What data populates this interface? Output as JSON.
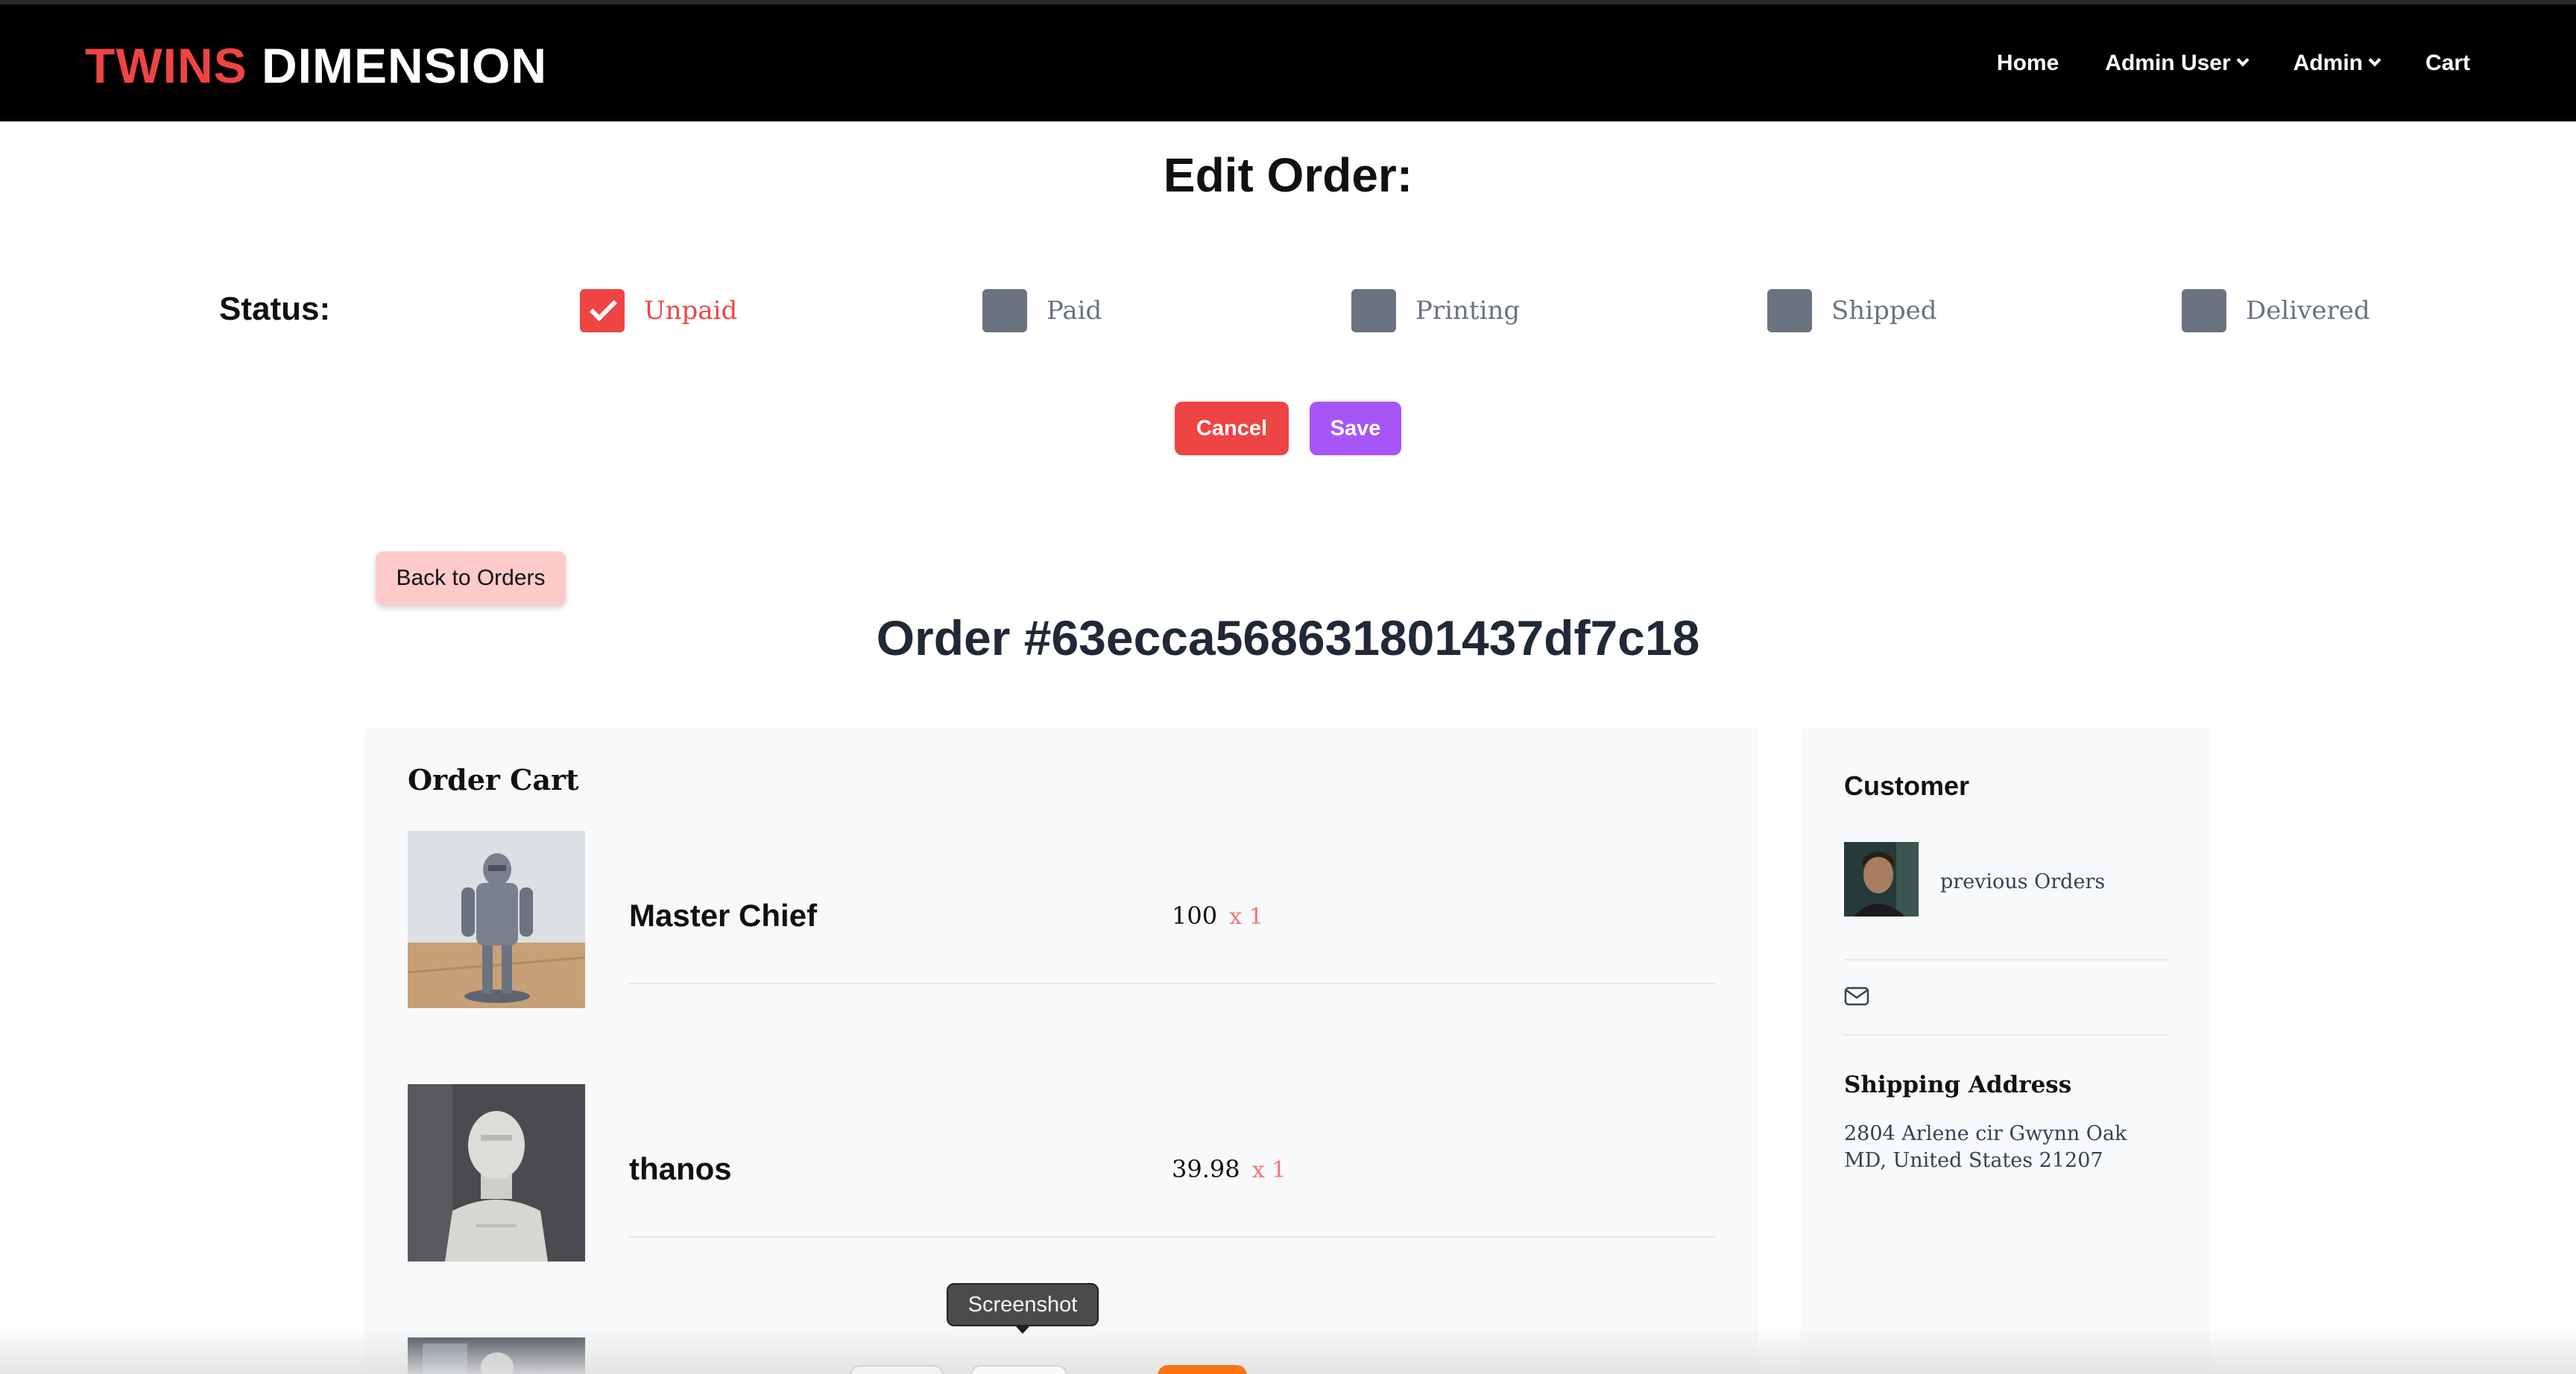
{
  "nav": {
    "brand_part1": "TWINS",
    "brand_part2": "DIMENSION",
    "items": [
      {
        "label": "Home",
        "dropdown": false
      },
      {
        "label": "Admin User",
        "dropdown": true
      },
      {
        "label": "Admin",
        "dropdown": true
      },
      {
        "label": "Cart",
        "dropdown": false
      }
    ]
  },
  "edit": {
    "title": "Edit Order:",
    "status_label": "Status:",
    "statuses": [
      {
        "label": "Unpaid",
        "checked": true
      },
      {
        "label": "Paid",
        "checked": false
      },
      {
        "label": "Printing",
        "checked": false
      },
      {
        "label": "Shipped",
        "checked": false
      },
      {
        "label": "Delivered",
        "checked": false
      }
    ],
    "cancel_label": "Cancel",
    "save_label": "Save"
  },
  "back_label": "Back to Orders",
  "order_title": "Order #63ecca568631801437df7c18",
  "cart": {
    "heading": "Order Cart",
    "items": [
      {
        "name": "Master Chief",
        "price": "100",
        "qty": "x 1"
      },
      {
        "name": "thanos",
        "price": "39.98",
        "qty": "x 1"
      }
    ]
  },
  "customer": {
    "heading": "Customer",
    "previous_orders": "previous Orders",
    "shipping_heading": "Shipping Address",
    "shipping_line1": "2804 Arlene cir Gwynn Oak",
    "shipping_line2": "MD, United States 21207"
  },
  "overlay": {
    "tooltip": "Screenshot"
  },
  "colors": {
    "accent_red": "#ef4444",
    "accent_purple": "#a855f7",
    "unchecked_box": "#6b7280",
    "panel_bg": "#f8f9fa"
  }
}
